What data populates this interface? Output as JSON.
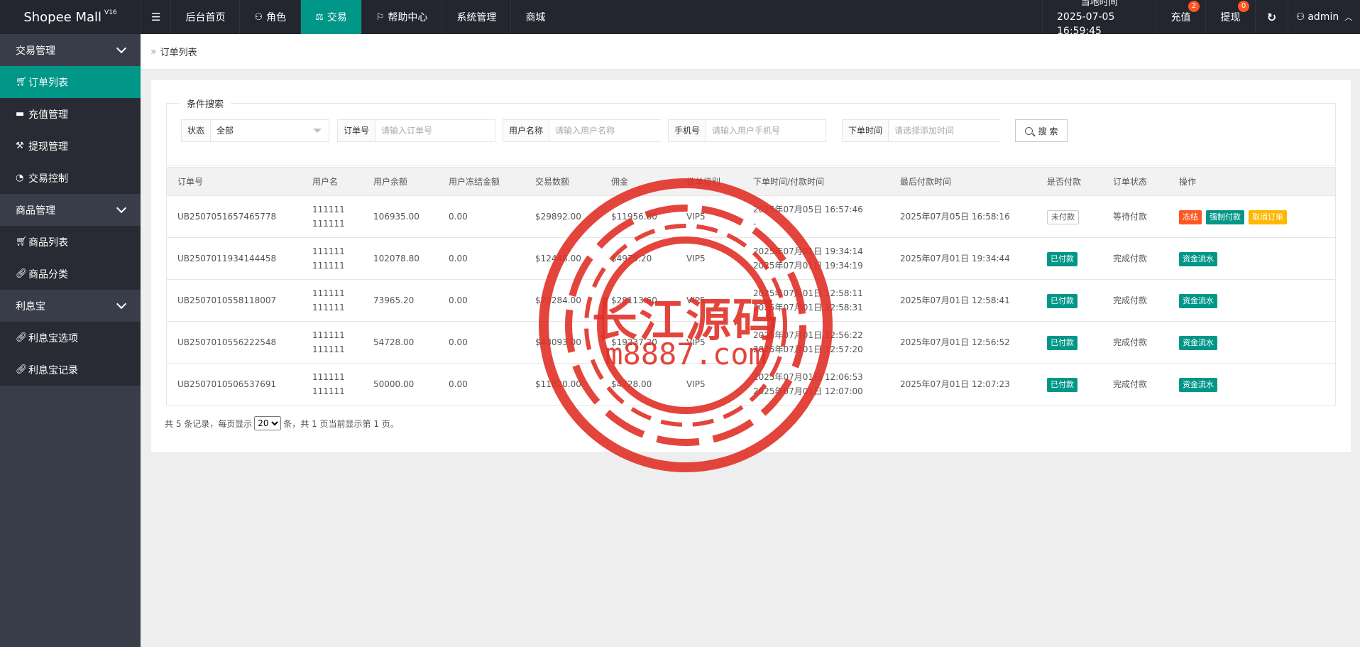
{
  "app": {
    "brand": "Shopee Mall",
    "version": "V16"
  },
  "topnav": {
    "items": [
      {
        "label": "后台首页",
        "icon": ""
      },
      {
        "label": "角色",
        "icon": "user-icon"
      },
      {
        "label": "交易",
        "icon": "scale-icon",
        "active": true
      },
      {
        "label": "帮助中心",
        "icon": "flag-icon"
      },
      {
        "label": "系统管理",
        "icon": ""
      },
      {
        "label": "商城",
        "icon": ""
      }
    ],
    "clock_label": "当地时间",
    "clock_value": "2025-07-05 16:59:45",
    "recharge_label": "充值",
    "recharge_count": "2",
    "withdraw_label": "提现",
    "withdraw_count": "0",
    "user_label": "admin"
  },
  "sidebar": {
    "groups": [
      {
        "label": "交易管理",
        "items": [
          "订单列表",
          "充值管理",
          "提现管理",
          "交易控制"
        ]
      },
      {
        "label": "商品管理",
        "items": [
          "商品列表",
          "商品分类"
        ]
      },
      {
        "label": "利息宝",
        "items": [
          "利息宝选项",
          "利息宝记录"
        ]
      }
    ]
  },
  "breadcrumb": {
    "current": "订单列表"
  },
  "search": {
    "legend": "条件搜索",
    "status_label": "状态",
    "status_value": "全部",
    "order_label": "订单号",
    "order_placeholder": "请输入订单号",
    "user_label": "用户名称",
    "user_placeholder": "请输入用户名称",
    "phone_label": "手机号",
    "phone_placeholder": "请输入用户手机号",
    "time_label": "下单时间",
    "time_placeholder": "请选择添加时间",
    "button_label": "搜 索"
  },
  "table": {
    "headers": [
      "订单号",
      "用户名",
      "用户余额",
      "用户冻结金额",
      "交易数额",
      "佣金",
      "做单级别",
      "下单时间/付款时间",
      "最后付款时间",
      "是否付款",
      "订单状态",
      "操作"
    ],
    "rows": [
      {
        "order": "UB2507051657465778",
        "user1": "111111",
        "user2": "111111",
        "balance": "106935.00",
        "frozen": "0.00",
        "amount": "$29892.00",
        "commission": "$11956.80",
        "level": "VIP5",
        "time1": "2025年07月05日 16:57:46",
        "time2": "-",
        "last": "2025年07月05日 16:58:16",
        "paid": "未付款",
        "status": "等待付款",
        "actions": [
          "冻结",
          "强制付款",
          "取消订单"
        ]
      },
      {
        "order": "UB2507011934144458",
        "user1": "111111",
        "user2": "111111",
        "balance": "102078.80",
        "frozen": "0.00",
        "amount": "$12448.00",
        "commission": "$4979.20",
        "level": "VIP5",
        "time1": "2025年07月01日 19:34:14",
        "time2": "2025年07月01日 19:34:19",
        "last": "2025年07月01日 19:34:44",
        "paid": "已付款",
        "status": "完成付款",
        "actions": [
          "资金流水"
        ]
      },
      {
        "order": "UB2507010558118007",
        "user1": "111111",
        "user2": "111111",
        "balance": "73965.20",
        "frozen": "0.00",
        "amount": "$70284.00",
        "commission": "$28113.60",
        "level": "VIP5",
        "time1": "2025年07月01日 12:58:11",
        "time2": "2025年07月01日 12:58:31",
        "last": "2025年07月01日 12:58:41",
        "paid": "已付款",
        "status": "完成付款",
        "actions": [
          "资金流水"
        ]
      },
      {
        "order": "UB2507010556222548",
        "user1": "111111",
        "user2": "111111",
        "balance": "54728.00",
        "frozen": "0.00",
        "amount": "$48093.00",
        "commission": "$19237.20",
        "level": "VIP5",
        "time1": "2025年07月01日 12:56:22",
        "time2": "2025年07月01日 12:57:20",
        "last": "2025年07月01日 12:56:52",
        "paid": "已付款",
        "status": "完成付款",
        "actions": [
          "资金流水"
        ]
      },
      {
        "order": "UB2507010506537691",
        "user1": "111111",
        "user2": "111111",
        "balance": "50000.00",
        "frozen": "0.00",
        "amount": "$11820.00",
        "commission": "$4728.00",
        "level": "VIP5",
        "time1": "2025年07月01日 12:06:53",
        "time2": "2025年07月01日 12:07:00",
        "last": "2025年07月01日 12:07:23",
        "paid": "已付款",
        "status": "完成付款",
        "actions": [
          "资金流水"
        ]
      }
    ]
  },
  "pager": {
    "prefix": "共 5 条记录，每页显示",
    "page_size": "20",
    "suffix": "条，共 1 页当前显示第 1 页。"
  },
  "watermark": {
    "title": "长江源码",
    "url": "m8887.com"
  },
  "colors": {
    "accent": "#009688",
    "header": "#23262e",
    "sidebar": "#393d49",
    "danger": "#ff5722",
    "warn": "#ffb800",
    "stamp": "#e03128"
  }
}
